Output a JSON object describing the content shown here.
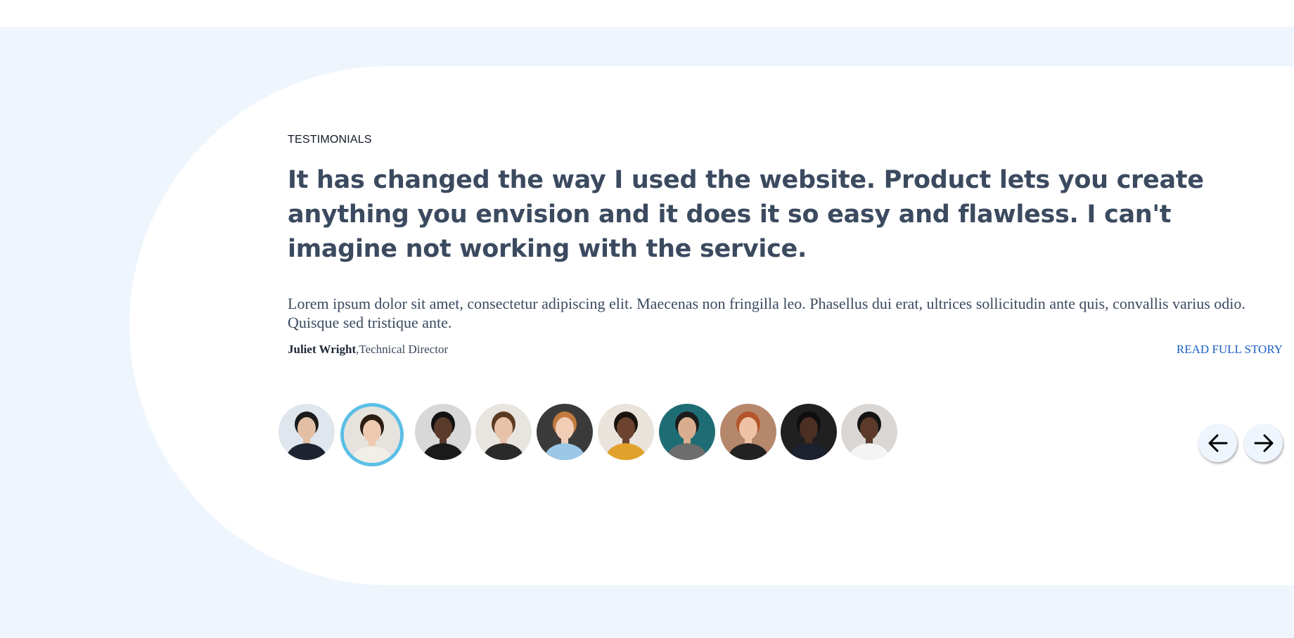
{
  "section": {
    "eyebrow": "TESTIMONIALS",
    "quote": "It has changed the way I used the website. Product lets you create anything you envision and it does it so easy and flawless. I can't imagine not working with the service.",
    "body": "Lorem ipsum dolor sit amet, consectetur adipiscing elit. Maecenas non fringilla leo. Phasellus dui erat, ultrices sollicitudin ante quis, convallis varius odio. Quisque sed tristique ante.",
    "author_name": "Juliet Wright",
    "author_sep": ",",
    "author_role": "Technical Director",
    "read_more": "READ FULL STORY"
  },
  "avatars": {
    "active_index": 1,
    "count": 10,
    "skin_tones": [
      "#e2bfa4",
      "#efc9b0",
      "#5a3a2a",
      "#e8c2a8",
      "#f1cdb5",
      "#6b4330",
      "#d9ae8f",
      "#efc2a6",
      "#4a2f22",
      "#5b3a2b"
    ],
    "hair_colors": [
      "#1a1a1a",
      "#2b1d14",
      "#111111",
      "#5a3a22",
      "#c27a3e",
      "#1a120e",
      "#1c1c1c",
      "#b4552c",
      "#0e0e0e",
      "#141414"
    ],
    "bg_colors": [
      "#dfe6ee",
      "#e6e2dd",
      "#d8d8d8",
      "#e8e4e0",
      "#3a3a3a",
      "#e9e3dc",
      "#1f6d74",
      "#b5876b",
      "#202020",
      "#d9d6d4"
    ],
    "shirt_colors": [
      "#1d2331",
      "#f2efe9",
      "#1a1a1a",
      "#2a2a2a",
      "#9cc8e8",
      "#e2a12a",
      "#6d6d6d",
      "#222222",
      "#1c2230",
      "#f4f4f4"
    ]
  },
  "nav": {
    "prev_icon": "arrow-left-icon",
    "next_icon": "arrow-right-icon"
  },
  "colors": {
    "band": "#eef5fd",
    "card": "#ffffff",
    "active_ring": "#5bbfe6",
    "link": "#1a5fc4"
  }
}
